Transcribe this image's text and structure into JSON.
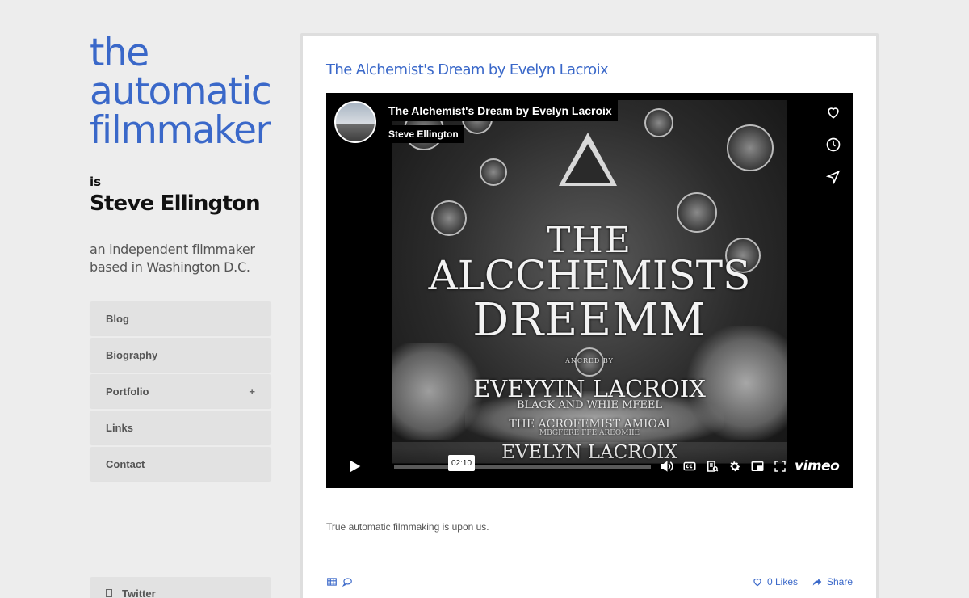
{
  "site": {
    "title_lines": [
      "the",
      "automatic",
      "filmmaker"
    ],
    "is_label": "is",
    "author": "Steve Ellington",
    "tagline_lines": [
      "an independent filmmaker",
      "based in Washington D.C."
    ],
    "accent_color": "#3a68c9"
  },
  "nav": {
    "items": [
      {
        "label": "Blog",
        "icon": ""
      },
      {
        "label": "Biography",
        "icon": ""
      },
      {
        "label": "Portfolio",
        "icon": "+"
      },
      {
        "label": "Links",
        "icon": ""
      },
      {
        "label": "Contact",
        "icon": ""
      }
    ]
  },
  "social": {
    "label": "Twitter",
    "icon": "twitter-icon"
  },
  "post": {
    "title": "The Alchemist's Dream by Evelyn Lacroix",
    "excerpt": "True automatic filmmaking is upon us.",
    "likes_label": "0 Likes",
    "share_label": "Share"
  },
  "video": {
    "title": "The Alchemist's Dream by Evelyn Lacroix",
    "author": "Steve Ellington",
    "time_tooltip": "02:10",
    "brand": "vimeo",
    "poster_lines": [
      "THE",
      "ALCCHEMISTS",
      "DREEMM",
      "ANCRED BY",
      "EVEYYIN LACROIX",
      "BLACK AND WHIE MFEEL",
      "THE ACROFEMIST AMIOAI",
      "MBGFERE FFE AREOMIIE",
      "EVELYN LACROIX"
    ]
  }
}
